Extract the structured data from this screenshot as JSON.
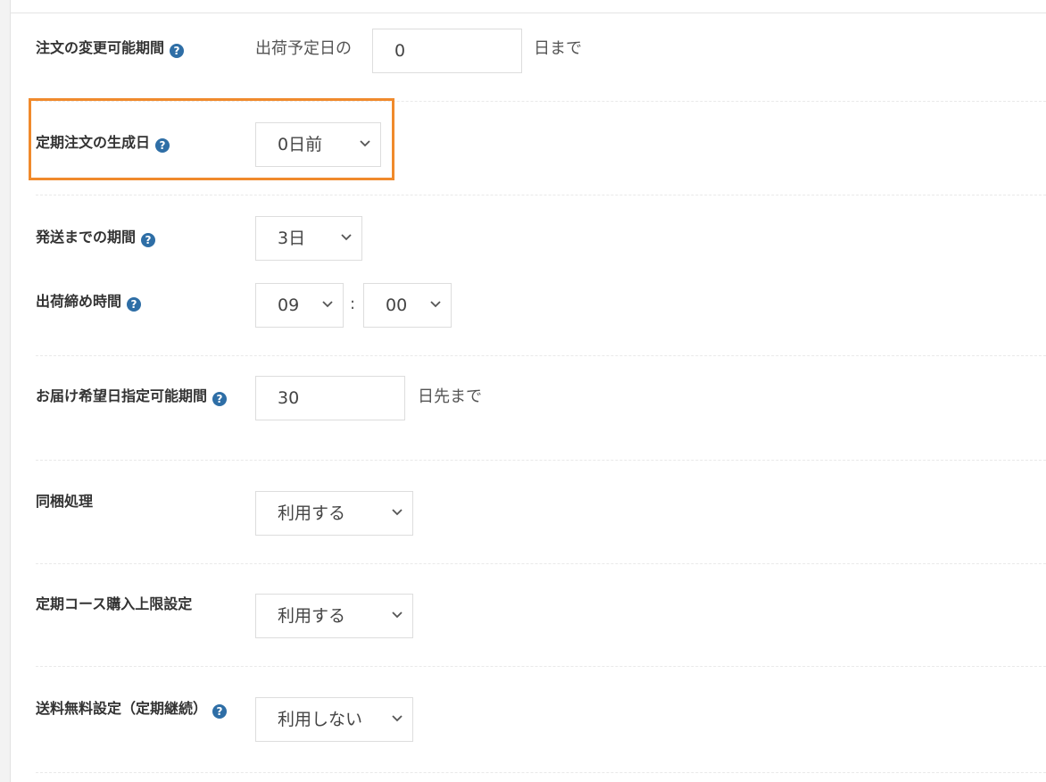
{
  "settings": {
    "change_period": {
      "label": "注文の変更可能期間",
      "prefix": "出荷予定日の",
      "value": "0",
      "suffix": "日まで"
    },
    "generation_day": {
      "label": "定期注文の生成日",
      "selected": "0日前"
    },
    "shipping_period": {
      "label": "発送までの期間",
      "selected": "3日"
    },
    "cutoff_time": {
      "label": "出荷締め時間",
      "hour": "09",
      "separator": ":",
      "minute": "00"
    },
    "delivery_range": {
      "label": "お届け希望日指定可能期間",
      "value": "30",
      "suffix": "日先まで"
    },
    "bundling": {
      "label": "同梱処理",
      "selected": "利用する"
    },
    "course_limit": {
      "label": "定期コース購入上限設定",
      "selected": "利用する"
    },
    "free_shipping": {
      "label": "送料無料設定（定期継続）",
      "selected": "利用しない"
    }
  },
  "help_glyph": "?",
  "colors": {
    "highlight": "#f08a2c",
    "help_icon": "#2e6ea6"
  }
}
